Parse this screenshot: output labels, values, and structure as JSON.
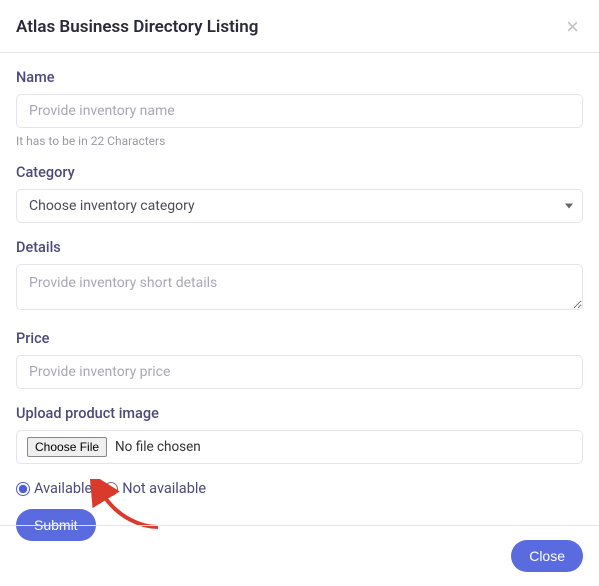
{
  "header": {
    "title": "Atlas Business Directory Listing",
    "close_icon": "×"
  },
  "form": {
    "name": {
      "label": "Name",
      "placeholder": "Provide inventory name",
      "help": "It has to be in 22 Characters"
    },
    "category": {
      "label": "Category",
      "selected": "Choose inventory category"
    },
    "details": {
      "label": "Details",
      "placeholder": "Provide inventory short details"
    },
    "price": {
      "label": "Price",
      "placeholder": "Provide inventory price"
    },
    "upload": {
      "label": "Upload product image",
      "button": "Choose File",
      "status": "No file chosen"
    },
    "availability": {
      "available_label": "Available",
      "not_available_label": "Not available"
    },
    "submit_label": "Submit"
  },
  "footer": {
    "close_label": "Close"
  }
}
